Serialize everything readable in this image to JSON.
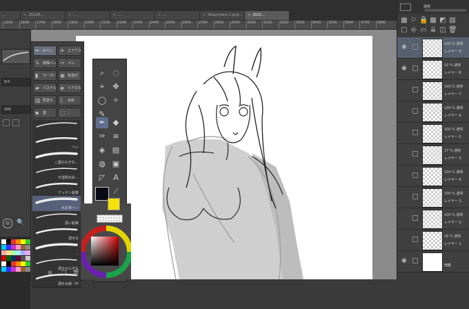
{
  "tabs": [
    {
      "label": "…"
    },
    {
      "label": "2022年…"
    },
    {
      "label": "…"
    },
    {
      "label": "…"
    },
    {
      "label": "…"
    },
    {
      "label": "…"
    },
    {
      "label": "Attachment 1.png…"
    },
    {
      "label": "2022…"
    }
  ],
  "ruler": [
    "1500",
    "1600",
    "1700",
    "1800",
    "1900",
    "2000",
    "2100",
    "2200",
    "2300",
    "2400",
    "2500",
    "2600",
    "2700",
    "2800",
    "2900",
    "3000",
    "3100",
    "3200",
    "3300",
    "3400",
    "3500",
    "3600",
    "3700",
    "3800"
  ],
  "left": {
    "size_value": "9.0",
    "opacity_value": "100"
  },
  "subtool": {
    "tabs": [
      {
        "label": "Gペン"
      },
      {
        "label": "エアブラシ"
      },
      {
        "label": "特殊ペン"
      },
      {
        "label": "ペン"
      },
      {
        "label": "マーカー"
      },
      {
        "label": "色混ぜ"
      },
      {
        "label": "パステル"
      },
      {
        "label": "リアルな"
      },
      {
        "label": "厚塗り"
      },
      {
        "label": "水彩"
      },
      {
        "label": "墨"
      },
      {
        "label": "…"
      }
    ],
    "brushes": [
      {
        "label": ""
      },
      {
        "label": "ペン"
      },
      {
        "label": "○重ねなぞれ…"
      },
      {
        "label": "不透明水彩…"
      },
      {
        "label": "デッサン鉛筆"
      },
      {
        "label": "水彩筆ペン"
      },
      {
        "label": "濃い鉛筆"
      },
      {
        "label": "濃ゆる"
      },
      {
        "label": "…"
      },
      {
        "label": "濃ゆるなぞれ"
      },
      {
        "label": "濃ゆる線（平"
      }
    ]
  },
  "layers": [
    {
      "mode": "100 % 通常",
      "name": "レイヤー 9"
    },
    {
      "mode": "10 % 通常",
      "name": "レイヤー 8"
    },
    {
      "mode": "100 % 通常",
      "name": "レイヤー 7"
    },
    {
      "mode": "100 % 通常",
      "name": "レイヤー 6"
    },
    {
      "mode": "100 % 通常",
      "name": "レイヤー 5"
    },
    {
      "mode": "27 % 通常",
      "name": "レイヤー 5"
    },
    {
      "mode": "100 % 通常",
      "name": "レイヤー 4"
    },
    {
      "mode": "100 % 通常",
      "name": "レイヤー 3"
    },
    {
      "mode": "100 % 通常",
      "name": "レイヤー 2"
    },
    {
      "mode": "26 % 通常",
      "name": "レイヤー 1"
    },
    {
      "mode": "",
      "name": "用紙"
    }
  ],
  "layer_panel": {
    "blend_mode": "通常",
    "opacity": "100"
  },
  "colors": {
    "main": "#0a0a14",
    "sub": "#f5e10a",
    "accent": "#6a6f7e"
  }
}
